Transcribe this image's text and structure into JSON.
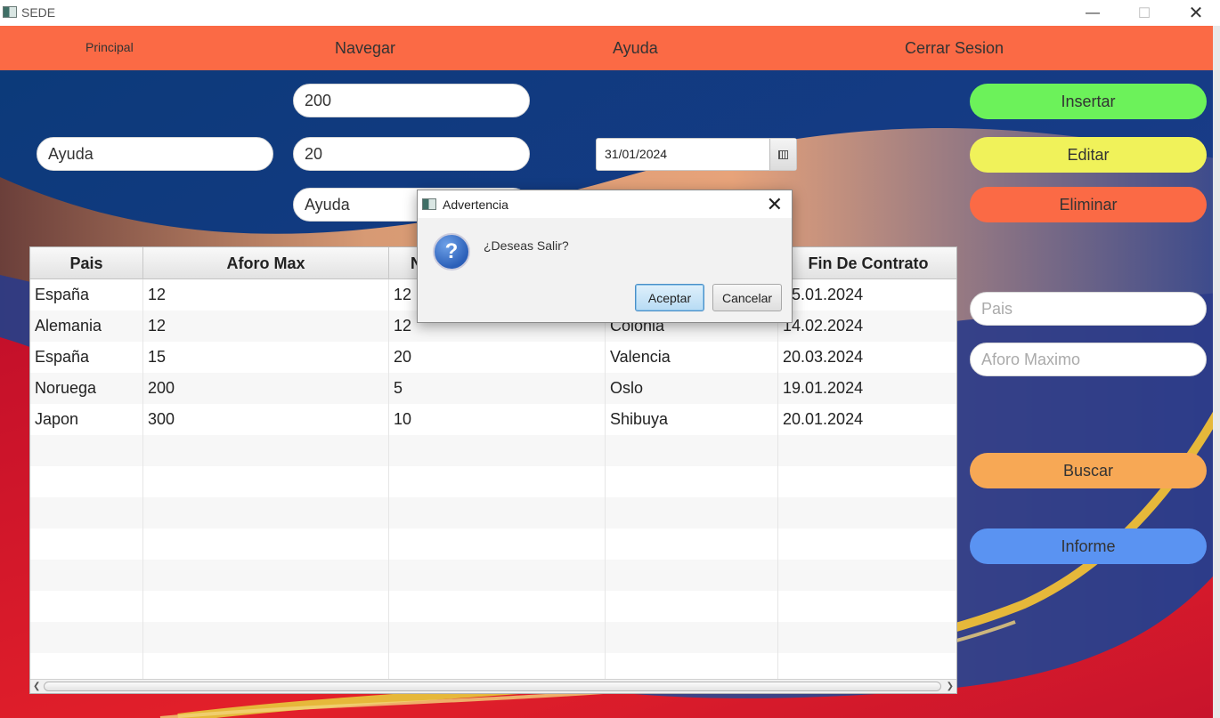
{
  "window": {
    "title": "SEDE"
  },
  "menu": {
    "principal": "Principal",
    "navegar": "Navegar",
    "ayuda": "Ayuda",
    "cerrar": "Cerrar Sesion"
  },
  "form": {
    "field_top": "200",
    "field_left": "Ayuda",
    "field_mid": "20",
    "field_bottom": "Ayuda",
    "date": "31/01/2024"
  },
  "actions": {
    "insertar": "Insertar",
    "editar": "Editar",
    "eliminar": "Eliminar",
    "buscar": "Buscar",
    "informe": "Informe"
  },
  "search": {
    "pais_placeholder": "Pais",
    "aforo_placeholder": "Aforo Maximo"
  },
  "table": {
    "headers": [
      "Pais",
      "Aforo Max",
      "N",
      "",
      "Fin De Contrato"
    ],
    "rows": [
      [
        "España",
        "12",
        "12",
        "",
        "15.01.2024"
      ],
      [
        "Alemania",
        "12",
        "12",
        "Colonia",
        "14.02.2024"
      ],
      [
        "España",
        "15",
        "20",
        "Valencia",
        "20.03.2024"
      ],
      [
        "Noruega",
        "200",
        "5",
        "Oslo",
        "19.01.2024"
      ],
      [
        "Japon",
        "300",
        "10",
        "Shibuya",
        "20.01.2024"
      ]
    ]
  },
  "dialog": {
    "title": "Advertencia",
    "message": "¿Deseas Salir?",
    "accept": "Aceptar",
    "cancel": "Cancelar"
  },
  "colors": {
    "menu": "#fb6a45",
    "insertar": "#6cf25a",
    "editar": "#f0f25a",
    "eliminar": "#fb6a45",
    "buscar": "#f7a855",
    "informe": "#5a93f2"
  }
}
